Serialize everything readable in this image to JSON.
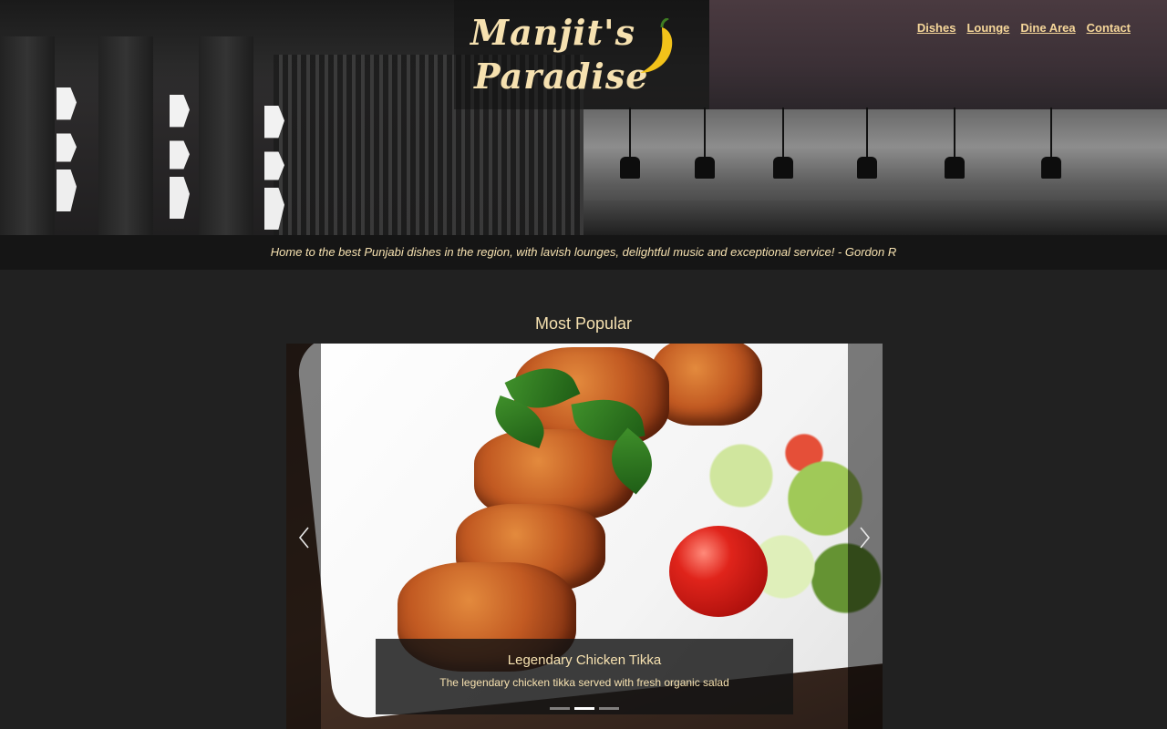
{
  "brand": {
    "line1": "Manjit's",
    "line2": "Paradise",
    "chili_icon": "chili-pepper-icon"
  },
  "nav": {
    "items": [
      {
        "label": "Dishes"
      },
      {
        "label": "Lounge"
      },
      {
        "label": "Dine Area"
      },
      {
        "label": "Contact"
      }
    ]
  },
  "hero": {
    "quote": "Home to the best Punjabi dishes in the region, with lavish lounges, delightful music and exceptional service! - Gordon R"
  },
  "section": {
    "title": "Most Popular"
  },
  "carousel": {
    "caption_title": "Legendary Chicken Tikka",
    "caption_text": "The legendary chicken tikka served with fresh organic salad",
    "prev_icon": "chevron-left-icon",
    "next_icon": "chevron-right-icon",
    "slide_count": 3,
    "active_index": 1
  },
  "colors": {
    "accent": "#f6e1b0",
    "background": "#212121"
  }
}
